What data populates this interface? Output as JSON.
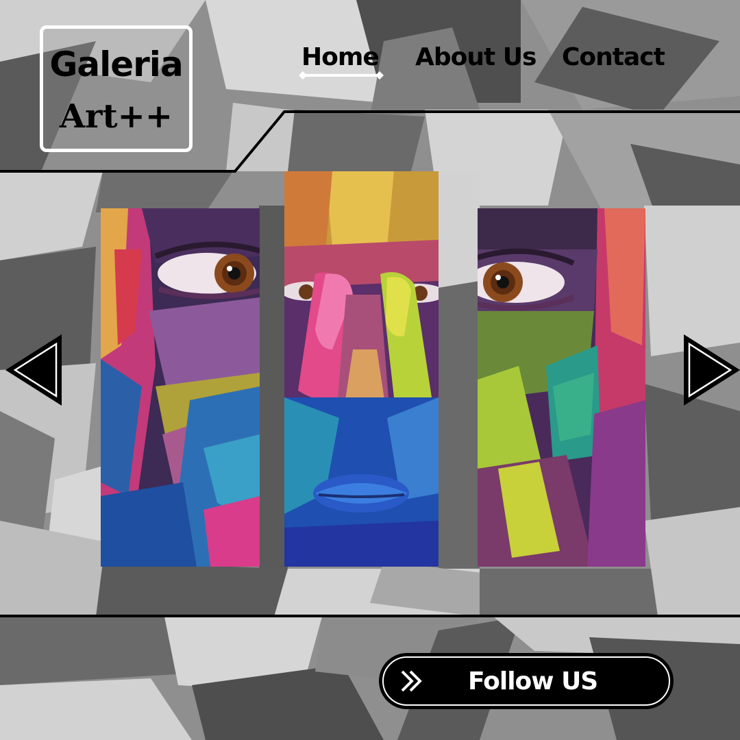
{
  "logo": {
    "line1": "Galeria",
    "line2": "Art++"
  },
  "nav": {
    "items": [
      {
        "label": "Home",
        "active": true
      },
      {
        "label": "About Us",
        "active": false
      },
      {
        "label": "Contact",
        "active": false
      }
    ]
  },
  "gallery": {
    "images": [
      {
        "subject": "painted face, left eye"
      },
      {
        "subject": "painted face, nose and lips"
      },
      {
        "subject": "painted face, right eye"
      }
    ]
  },
  "controls": {
    "prev_icon": "triangle-left-icon",
    "next_icon": "triangle-right-icon"
  },
  "cta": {
    "label": "Follow US",
    "icon": "double-chevron-right-icon"
  },
  "colors": {
    "background_dark": "#555555",
    "background_mid": "#8c8c8c",
    "background_light": "#d6d6d6",
    "text": "#000000",
    "button_bg": "#000000",
    "button_text": "#ffffff"
  }
}
